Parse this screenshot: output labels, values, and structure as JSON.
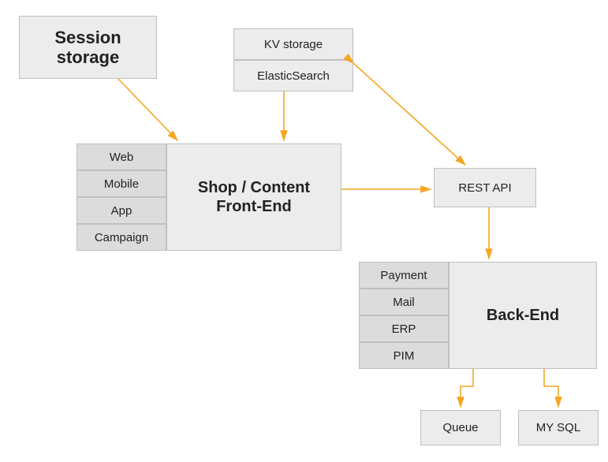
{
  "session": {
    "title": "Session\nstorage"
  },
  "kv": {
    "label": "KV storage"
  },
  "es": {
    "label": "ElasticSearch"
  },
  "frontend": {
    "title": "Shop / Content\nFront-End",
    "channels": [
      "Web",
      "Mobile",
      "App",
      "Campaign"
    ]
  },
  "restapi": {
    "label": "REST API"
  },
  "backend": {
    "title": "Back-End",
    "services": [
      "Payment",
      "Mail",
      "ERP",
      "PIM"
    ]
  },
  "queue": {
    "label": "Queue"
  },
  "mysql": {
    "label": "MY SQL"
  },
  "colors": {
    "arrow": "#f5a623",
    "box_bg": "#ececec",
    "cell_bg": "#dcdcdc",
    "border": "#bfbfbf"
  },
  "diagram": {
    "type": "architecture",
    "edges": [
      [
        "Session storage",
        "Shop / Content Front-End"
      ],
      [
        "KV storage / ElasticSearch",
        "Shop / Content Front-End"
      ],
      [
        "KV storage / ElasticSearch",
        "REST API",
        "bidirectional"
      ],
      [
        "Shop / Content Front-End",
        "REST API"
      ],
      [
        "REST API",
        "Back-End"
      ],
      [
        "Back-End",
        "Queue"
      ],
      [
        "Back-End",
        "MY SQL"
      ]
    ]
  }
}
